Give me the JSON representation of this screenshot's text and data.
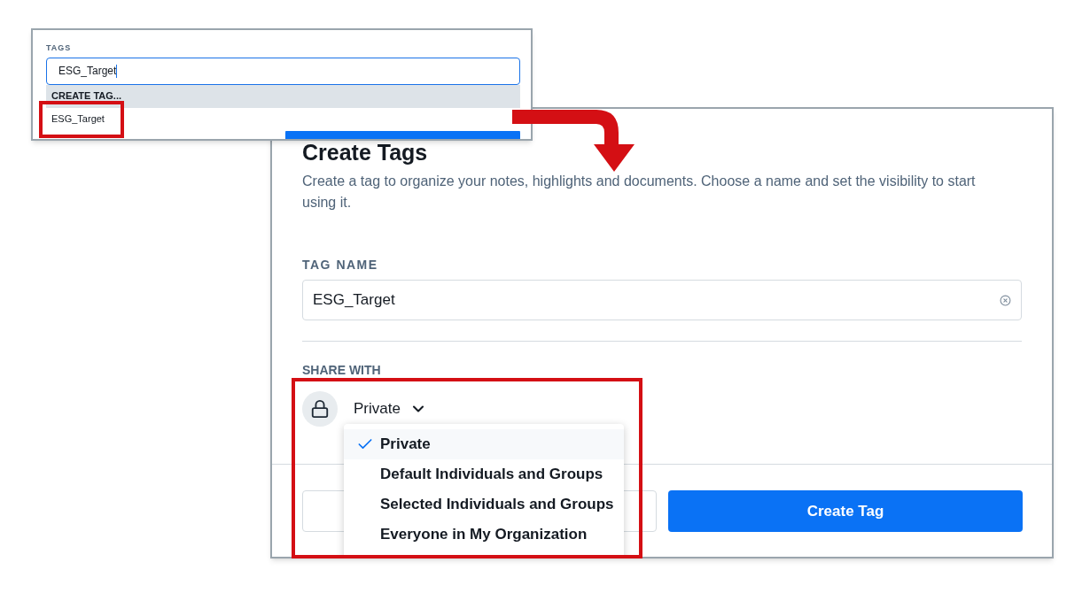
{
  "tag_picker": {
    "label": "TAGS",
    "value": "ESG_Target",
    "suggestions": [
      {
        "kind": "action",
        "label": "CREATE TAG...",
        "highlighted": true
      },
      {
        "kind": "option",
        "label": "ESG_Target",
        "highlighted": false
      }
    ]
  },
  "dialog": {
    "title": "Create Tags",
    "description": "Create a tag to organize your notes, highlights and documents. Choose a name and set the visibility to start using it.",
    "name_field": {
      "label": "TAG NAME",
      "value": "ESG_Target"
    },
    "share": {
      "label": "SHARE WITH",
      "value": "Private",
      "expanded": true,
      "options": [
        {
          "label": "Private",
          "selected": true
        },
        {
          "label": "Default Individuals and Groups",
          "selected": false
        },
        {
          "label": "Selected Individuals and Groups",
          "selected": false
        },
        {
          "label": "Everyone in My Organization",
          "selected": false
        }
      ]
    },
    "buttons": [
      {
        "kind": "secondary"
      },
      {
        "kind": "primary",
        "label": "Create Tag"
      }
    ]
  }
}
